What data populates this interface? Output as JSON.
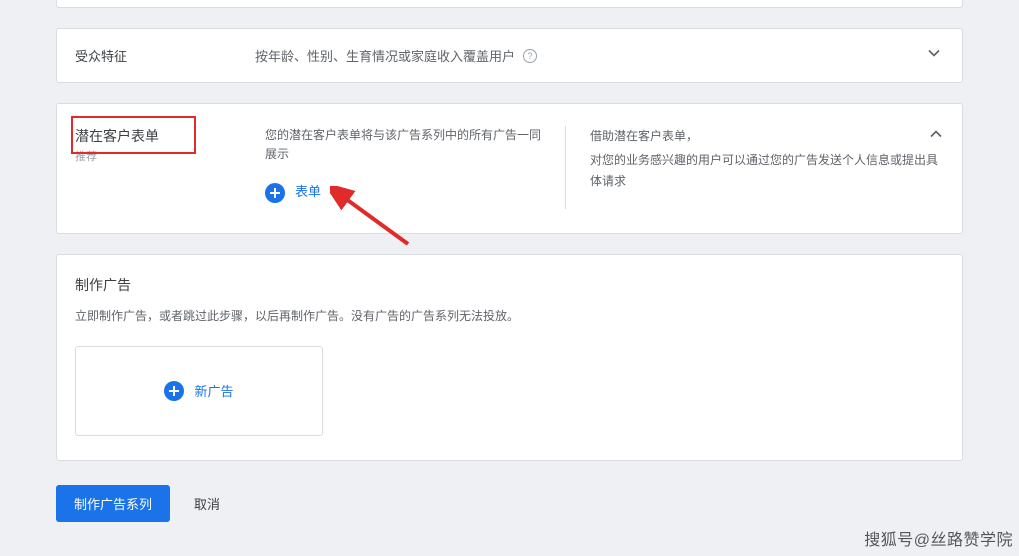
{
  "audience": {
    "label": "受众特征",
    "desc": "按年龄、性别、生育情况或家庭收入覆盖用户"
  },
  "lead": {
    "title": "潜在客户表单",
    "sub": "推荐",
    "desc": "您的潜在客户表单将与该广告系列中的所有广告一同展示",
    "right_title": "借助潜在客户表单，",
    "right_desc": "对您的业务感兴趣的用户可以通过您的广告发送个人信息或提出具体请求",
    "add_label": "表单"
  },
  "create": {
    "title": "制作广告",
    "desc": "立即制作广告，或者跳过此步骤，以后再制作广告。没有广告的广告系列无法投放。",
    "new_ad_label": "新广告"
  },
  "footer": {
    "primary": "制作广告系列",
    "cancel": "取消"
  },
  "watermark": "搜狐号@丝路赞学院"
}
